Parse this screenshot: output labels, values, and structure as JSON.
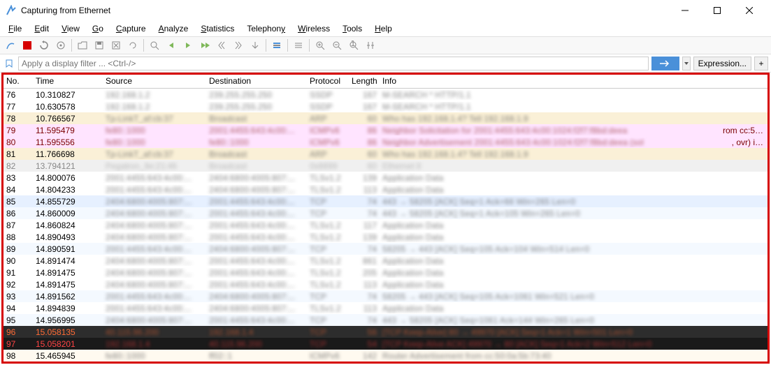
{
  "window": {
    "title": "Capturing from Ethernet"
  },
  "menu": {
    "file": "File",
    "edit": "Edit",
    "view": "View",
    "go": "Go",
    "capture": "Capture",
    "analyze": "Analyze",
    "statistics": "Statistics",
    "telephony": "Telephony",
    "wireless": "Wireless",
    "tools": "Tools",
    "help": "Help"
  },
  "filter": {
    "placeholder": "Apply a display filter ... <Ctrl-/>",
    "expression": "Expression...",
    "plus": "+"
  },
  "columns": {
    "no": "No.",
    "time": "Time",
    "source": "Source",
    "destination": "Destination",
    "protocol": "Protocol",
    "length": "Length",
    "info": "Info"
  },
  "packets": [
    {
      "no": "76",
      "time": "10.310827",
      "cls": "c-white",
      "src": "192.168.1.2",
      "dst": "239.255.255.250",
      "proto": "SSDP",
      "len": "167",
      "info": "M-SEARCH * HTTP/1.1"
    },
    {
      "no": "77",
      "time": "10.630578",
      "cls": "c-white",
      "src": "192.168.1.2",
      "dst": "239.255.255.250",
      "proto": "SSDP",
      "len": "167",
      "info": "M-SEARCH * HTTP/1.1"
    },
    {
      "no": "78",
      "time": "10.766567",
      "cls": "c-yellow",
      "src": "Tp-LinkT_af:cb:37",
      "dst": "Broadcast",
      "proto": "ARP",
      "len": "60",
      "info": "Who has 192.168.1.4? Tell 192.168.1.9"
    },
    {
      "no": "79",
      "time": "11.595479",
      "cls": "c-pink",
      "src": "fe80::1000",
      "dst": "2001:4455:643:4c00:...",
      "proto": "ICMPv6",
      "len": "86",
      "info": "Neighbor Solicitation for 2001:4455:643:4c00:1024:f2f7:f8bd:deea",
      "tail": "rom cc:5…"
    },
    {
      "no": "80",
      "time": "11.595556",
      "cls": "c-pink",
      "src": "fe80::1000",
      "dst": "fe80::1000",
      "proto": "ICMPv6",
      "len": "86",
      "info": "Neighbor Advertisement 2001:4455:643:4c00:1024:f2f7:f8bd:deea (sol",
      "tail": ", ovr) i…"
    },
    {
      "no": "81",
      "time": "11.766698",
      "cls": "c-yellow",
      "src": "Tp-LinkT_af:cb:37",
      "dst": "Broadcast",
      "proto": "ARP",
      "len": "60",
      "info": "Who has 192.168.1.4? Tell 192.168.1.9"
    },
    {
      "no": "82",
      "time": "13.794121",
      "cls": "c-grey",
      "src": "Pegatron_9e:21:46",
      "dst": "Broadcast",
      "proto": "0x8899",
      "len": "60",
      "info": "Ethernet II"
    },
    {
      "no": "83",
      "time": "14.800076",
      "cls": "c-white",
      "src": "2001:4455:643:4c00:...",
      "dst": "2404:6800:4005:807:...",
      "proto": "TLSv1.2",
      "len": "139",
      "info": "Application Data"
    },
    {
      "no": "84",
      "time": "14.804233",
      "cls": "c-white",
      "src": "2001:4455:643:4c00:...",
      "dst": "2404:6800:4005:807:...",
      "proto": "TLSv1.2",
      "len": "113",
      "info": "Application Data"
    },
    {
      "no": "85",
      "time": "14.855729",
      "cls": "c-blue",
      "src": "2404:6800:4005:807:...",
      "dst": "2001:4455:643:4c00:...",
      "proto": "TCP",
      "len": "74",
      "info": "443 → 58205 [ACK] Seq=1 Ack=66 Win=265 Len=0"
    },
    {
      "no": "86",
      "time": "14.860009",
      "cls": "c-lblue",
      "src": "2404:6800:4005:807:...",
      "dst": "2001:4455:643:4c00:...",
      "proto": "TCP",
      "len": "74",
      "info": "443 → 58205 [ACK] Seq=1 Ack=105 Win=265 Len=0"
    },
    {
      "no": "87",
      "time": "14.860824",
      "cls": "c-white",
      "src": "2404:6800:4005:807:...",
      "dst": "2001:4455:643:4c00:...",
      "proto": "TLSv1.2",
      "len": "117",
      "info": "Application Data"
    },
    {
      "no": "88",
      "time": "14.890493",
      "cls": "c-white",
      "src": "2404:6800:4005:807:...",
      "dst": "2001:4455:643:4c00:...",
      "proto": "TLSv1.2",
      "len": "139",
      "info": "Application Data"
    },
    {
      "no": "89",
      "time": "14.890591",
      "cls": "c-lblue",
      "src": "2001:4455:643:4c00:...",
      "dst": "2404:6800:4005:807:...",
      "proto": "TCP",
      "len": "74",
      "info": "58205 → 443 [ACK] Seq=105 Ack=104 Win=514 Len=0"
    },
    {
      "no": "90",
      "time": "14.891474",
      "cls": "c-white",
      "src": "2404:6800:4005:807:...",
      "dst": "2001:4455:643:4c00:...",
      "proto": "TLSv1.2",
      "len": "861",
      "info": "Application Data"
    },
    {
      "no": "91",
      "time": "14.891475",
      "cls": "c-white",
      "src": "2404:6800:4005:807:...",
      "dst": "2001:4455:643:4c00:...",
      "proto": "TLSv1.2",
      "len": "205",
      "info": "Application Data"
    },
    {
      "no": "92",
      "time": "14.891475",
      "cls": "c-white",
      "src": "2404:6800:4005:807:...",
      "dst": "2001:4455:643:4c00:...",
      "proto": "TLSv1.2",
      "len": "113",
      "info": "Application Data"
    },
    {
      "no": "93",
      "time": "14.891562",
      "cls": "c-lblue",
      "src": "2001:4455:643:4c00:...",
      "dst": "2404:6800:4005:807:...",
      "proto": "TCP",
      "len": "74",
      "info": "58205 → 443 [ACK] Seq=105 Ack=1061 Win=521 Len=0"
    },
    {
      "no": "94",
      "time": "14.894839",
      "cls": "c-white",
      "src": "2001:4455:643:4c00:...",
      "dst": "2404:6800:4005:807:...",
      "proto": "TLSv1.2",
      "len": "113",
      "info": "Application Data"
    },
    {
      "no": "95",
      "time": "14.956995",
      "cls": "c-lblue",
      "src": "2404:6800:4005:807:...",
      "dst": "2001:4455:643:4c00:...",
      "proto": "TCP",
      "len": "74",
      "info": "443 → 58205 [ACK] Seq=1061 Ack=144 Win=265 Len=0"
    },
    {
      "no": "96",
      "time": "15.058135",
      "cls": "c-dark",
      "src": "40.115.96.200",
      "dst": "192.168.1.4",
      "proto": "TCP",
      "len": "56",
      "info": "[TCP Keep-Alive] 80 → 49970 [ACK] Seq=1 Ack=1 Win=501 Len=0"
    },
    {
      "no": "97",
      "time": "15.058201",
      "cls": "c-darkred",
      "src": "192.168.1.4",
      "dst": "40.115.96.200",
      "proto": "TCP",
      "len": "54",
      "info": "[TCP Keep-Alive ACK] 49970 → 80 [ACK] Seq=1 Ack=2 Win=512 Len=0"
    },
    {
      "no": "98",
      "time": "15.465945",
      "cls": "c-pale",
      "src": "fe80::1000",
      "dst": "ff02::1",
      "proto": "ICMPv6",
      "len": "142",
      "info": "Router Advertisement from cc:50:0a:5b:73:40"
    }
  ]
}
